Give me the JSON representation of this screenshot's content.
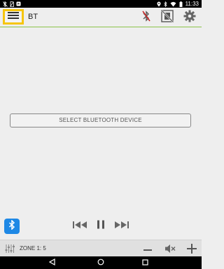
{
  "status_bar": {
    "time": "11:33",
    "icons": [
      "bluetooth-off-icon",
      "no-sim-icon",
      "notification-icon",
      "location-icon",
      "bluetooth-icon",
      "wifi-icon",
      "battery-icon"
    ]
  },
  "toolbar": {
    "title": "BT",
    "icons": [
      "menu-icon",
      "bluetooth-disconnected-icon",
      "no-device-icon",
      "settings-icon"
    ]
  },
  "main": {
    "select_device_label": "SELECT BLUETOOTH DEVICE"
  },
  "player": {
    "icons": [
      "bluetooth-badge-icon",
      "previous-track-icon",
      "pause-icon",
      "next-track-icon"
    ]
  },
  "zone_bar": {
    "zone_label": "ZONE 1: 5",
    "icons": [
      "equalizer-icon",
      "volume-down-icon",
      "mute-icon",
      "volume-up-icon"
    ]
  },
  "nav_bar": {
    "icons": [
      "back-icon",
      "home-icon",
      "recents-icon"
    ]
  },
  "colors": {
    "accent_green": "#8bc34a",
    "highlight_yellow": "#f6c50d",
    "bluetooth_blue": "#1e88e5",
    "background": "#eeeeee"
  }
}
